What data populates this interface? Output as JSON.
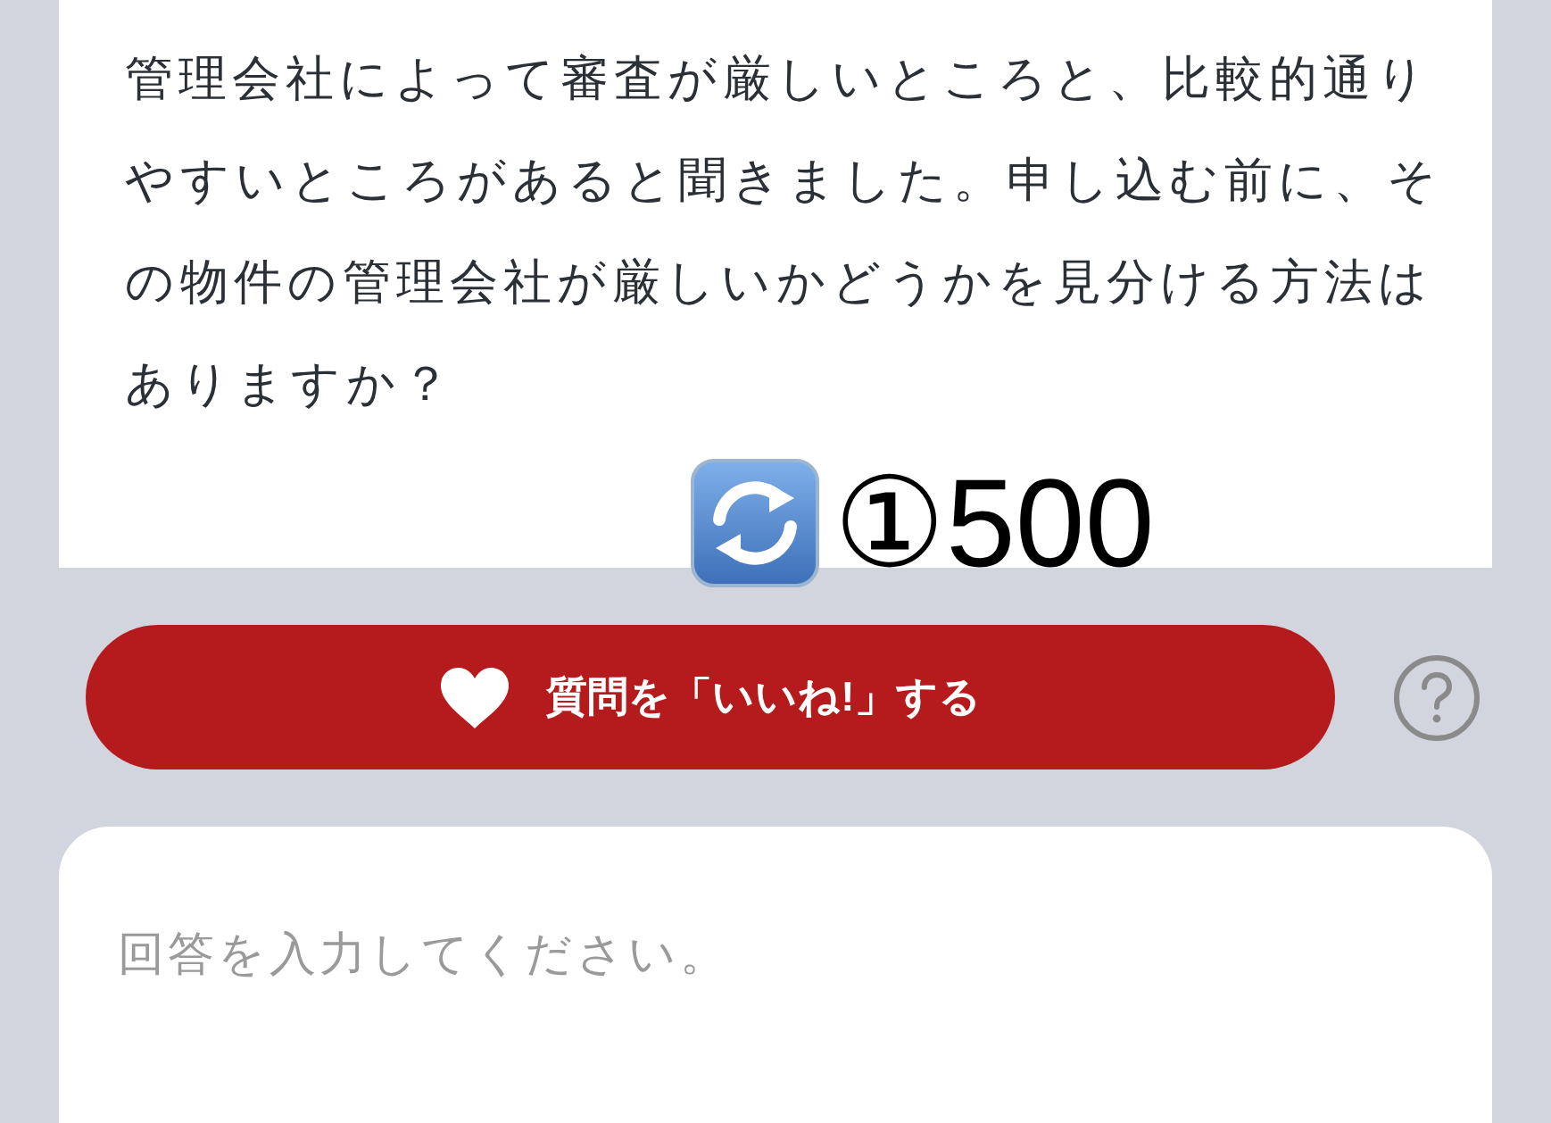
{
  "question": {
    "text": "管理会社によって審査が厳しいところと、比較的通りやすいところがあると聞きました。申し込む前に、その物件の管理会社が厳しいかどうかを見分ける方法はありますか？"
  },
  "overlay": {
    "text": "①500"
  },
  "like_button": {
    "label": "質問を「いいね!」する"
  },
  "answer_field": {
    "placeholder": "回答を入力してください。"
  }
}
